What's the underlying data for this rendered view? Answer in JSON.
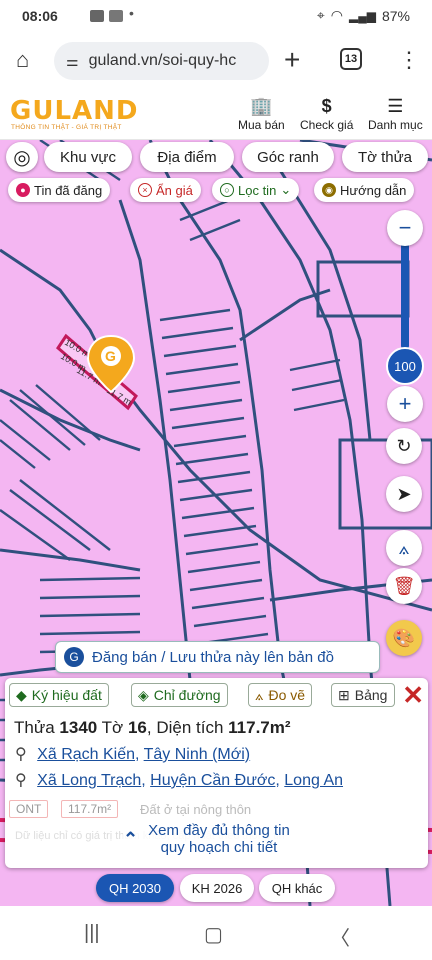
{
  "status": {
    "time": "08:06",
    "battery": "87%"
  },
  "browser": {
    "url": "guland.vn/soi-quy-hc",
    "tab_count": "13"
  },
  "site": {
    "logo": "GULAND",
    "tagline": "THÔNG TIN THẬT - GIÁ TRỊ THẬT",
    "nav": [
      {
        "label": "Mua bán"
      },
      {
        "label": "Check giá"
      },
      {
        "label": "Danh mục"
      }
    ]
  },
  "filters": {
    "chips": [
      {
        "label": "Khu vực"
      },
      {
        "label": "Địa điểm"
      },
      {
        "label": "Góc ranh"
      },
      {
        "label": "Tờ thửa"
      }
    ],
    "chips2": [
      {
        "label": "Tin đã đăng"
      },
      {
        "label": "Ẩn giá"
      },
      {
        "label": "Lọc tin"
      },
      {
        "label": "Hướng dẫn"
      }
    ]
  },
  "map": {
    "zoom_level": "100",
    "parcel_dims": [
      "10.0 m",
      "11.7 m",
      "10.0 m",
      "11.7 m"
    ],
    "colors": {
      "land": "#f4b6f2",
      "road": "#30507e",
      "accent": "#f4a81d"
    }
  },
  "post_button": {
    "label": "Đăng bán / Lưu thửa này lên bản đồ"
  },
  "panel": {
    "tabs": [
      {
        "label": "Ký hiệu đất"
      },
      {
        "label": "Chỉ đường"
      },
      {
        "label": "Đo vẽ"
      },
      {
        "label": "Bảng"
      }
    ],
    "title_prefix": "Thửa",
    "parcel_no": "1340",
    "sheet_prefix": "Tờ",
    "sheet_no": "16",
    "area_prefix": ", Diện tích",
    "area": "117.7m²",
    "loc1": {
      "commune": "Xã Rạch Kiến",
      "province": "Tây Ninh (Mới)"
    },
    "loc2": {
      "commune": "Xã Long Trạch",
      "district": "Huyện Cần Đước",
      "province": "Long An"
    },
    "land_code": "ONT",
    "land_area": "117.7m²",
    "land_type": "Đất ở tại nông thôn",
    "note": "Dữ liệu chỉ có giá trị tham khảo, cập nhật theo thông tin",
    "more_line1": "Xem đầy đủ thông tin",
    "more_line2": "quy hoạch chi tiết"
  },
  "bottom_chips": [
    {
      "label": "QH 2030"
    },
    {
      "label": "KH 2026"
    },
    {
      "label": "QH khác"
    }
  ]
}
